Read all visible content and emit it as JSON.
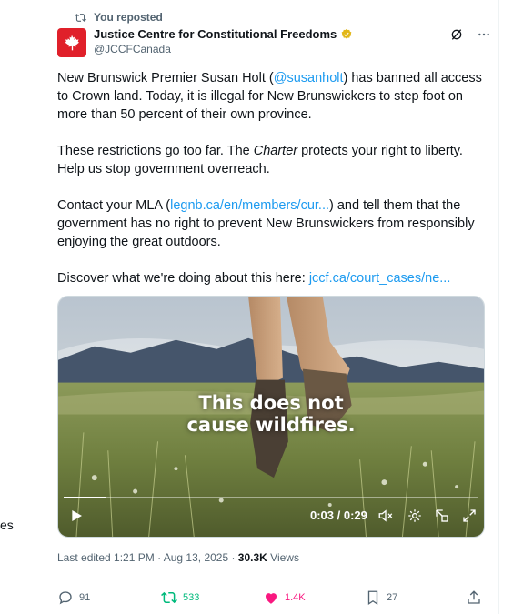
{
  "repost": {
    "label": "You reposted"
  },
  "author": {
    "name": "Justice Centre for Constitutional Freedoms",
    "handle": "@JCCFCanada"
  },
  "tweet": {
    "p1_before": "New Brunswick Premier Susan Holt (",
    "p1_mention": "@susanholt",
    "p1_after": ") has banned all access to Crown land. Today, it is illegal for New Brunswickers to step foot on more than 50 percent of their own province.",
    "p2_before": "These restrictions go too far. The ",
    "p2_italic": "Charter",
    "p2_after": " protects your right to liberty. Help us stop government overreach.",
    "p3_before": "Contact your MLA (",
    "p3_link": "legnb.ca/en/members/cur...",
    "p3_after": ") and tell them that the government has no right to prevent New Brunswickers from responsibly enjoying the great outdoors.",
    "p4_before": "Discover what we're doing about this here: ",
    "p4_link": "jccf.ca/court_cases/ne..."
  },
  "video": {
    "caption_line1": "This does not",
    "caption_line2": "cause wildfires.",
    "time": "0:03 / 0:29",
    "progress": 0.1
  },
  "meta": {
    "edited": "Last edited 1:21 PM · Aug 13, 2025 · ",
    "views_count": "30.3K",
    "views_label": " Views"
  },
  "actions": {
    "replies": "91",
    "reposts": "533",
    "likes": "1.4K",
    "bookmarks": "27"
  },
  "left_clip": "es",
  "colors": {
    "accent": "#1d9bf0",
    "repost": "#00ba7c",
    "like": "#f91880",
    "brand": "#e0202a"
  }
}
